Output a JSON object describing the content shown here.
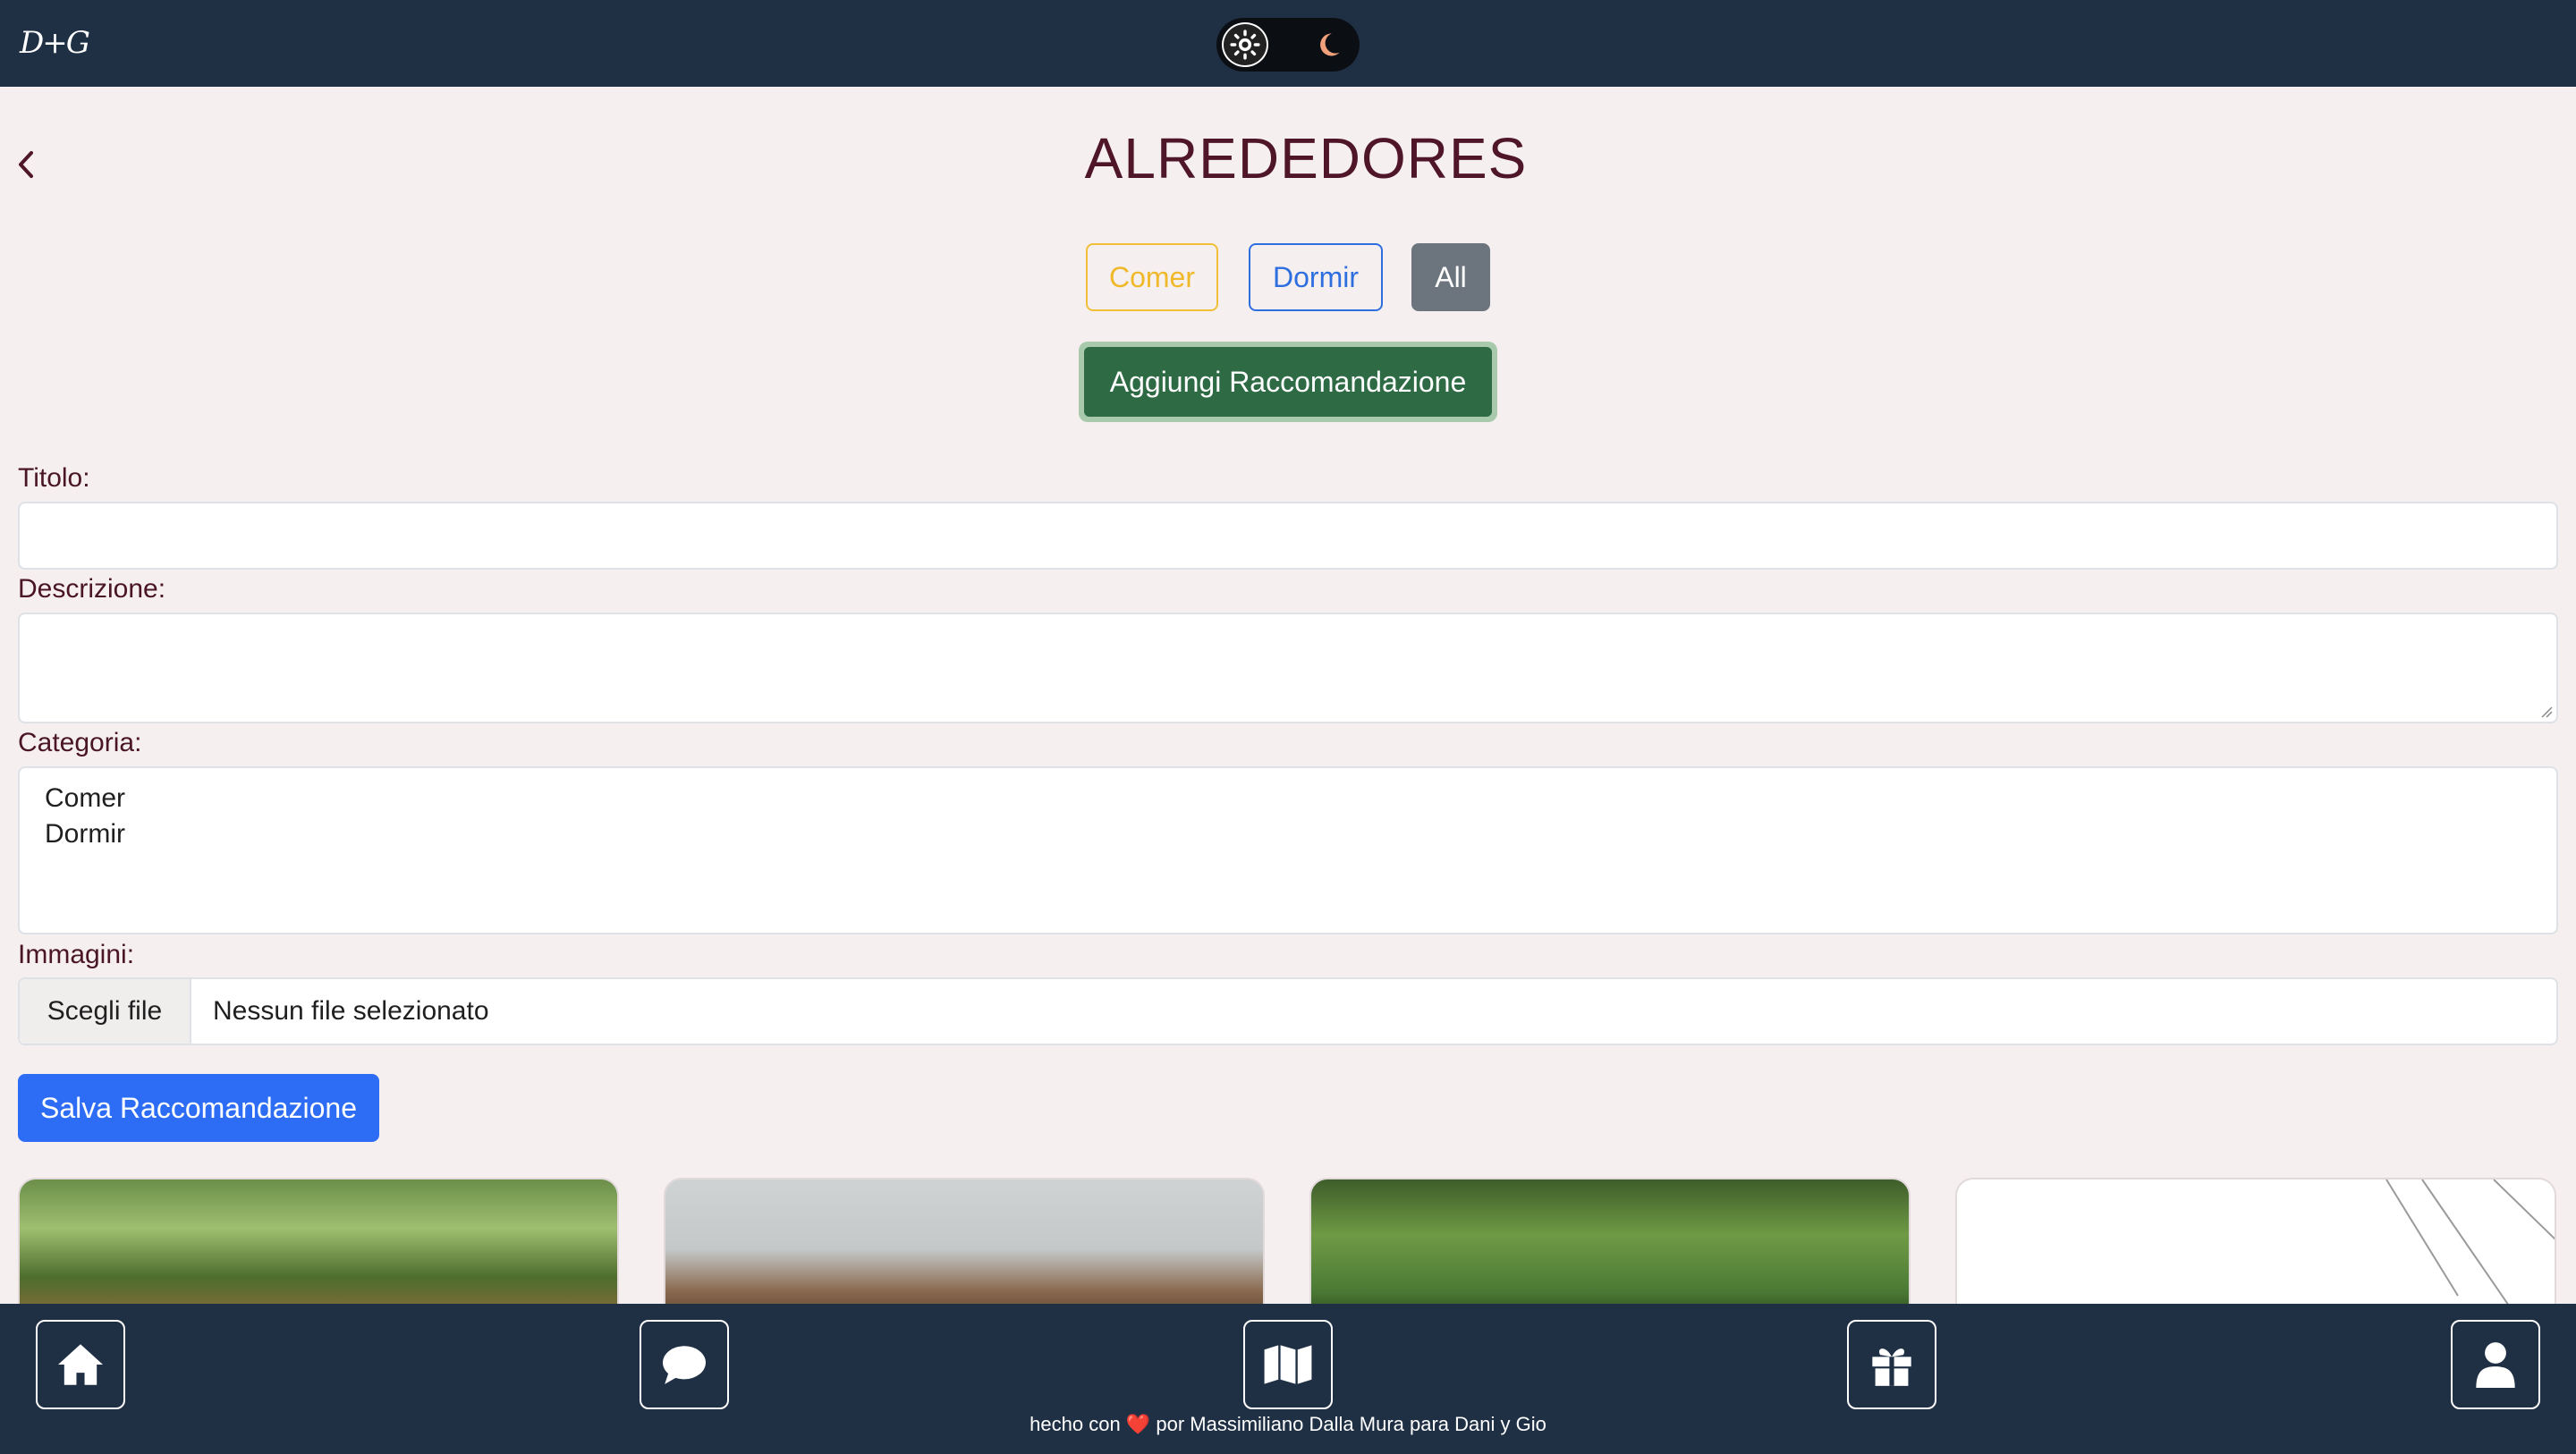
{
  "header": {
    "logo": "D+G",
    "theme_toggle": {
      "sun_icon": "sun-icon",
      "moon_icon": "moon-icon",
      "moon_color": "#f0a07a"
    }
  },
  "page": {
    "title": "ALREDEDORES",
    "back_icon": "chevron-left-icon"
  },
  "filters": [
    {
      "label": "Comer",
      "color": "#f0b92a"
    },
    {
      "label": "Dormir",
      "color": "#2e6fe0"
    },
    {
      "label": "All",
      "color": "#6c757d",
      "active": true
    }
  ],
  "add_button": {
    "label": "Aggiungi Raccomandazione",
    "color": "#2e6b45"
  },
  "form": {
    "title_label": "Titolo:",
    "title_value": "",
    "description_label": "Descrizione:",
    "description_value": "",
    "category_label": "Categoria:",
    "category_options": [
      "Comer",
      "Dormir"
    ],
    "images_label": "Immagini:",
    "file_button": "Scegli file",
    "file_status": "Nessun file selezionato",
    "save_button": "Salva Raccomandazione"
  },
  "bottom_nav": {
    "items": [
      {
        "icon": "home-icon"
      },
      {
        "icon": "chat-bubble-icon"
      },
      {
        "icon": "map-icon"
      },
      {
        "icon": "gift-icon"
      },
      {
        "icon": "user-icon"
      }
    ],
    "footer_before": "hecho con",
    "footer_heart": "❤️",
    "footer_after": "por Massimiliano Dalla Mura para Dani y Gio"
  },
  "colors": {
    "navbar": "#1f3045",
    "background": "#f5efef",
    "title": "#4f1529",
    "primary": "#2d6df6"
  }
}
